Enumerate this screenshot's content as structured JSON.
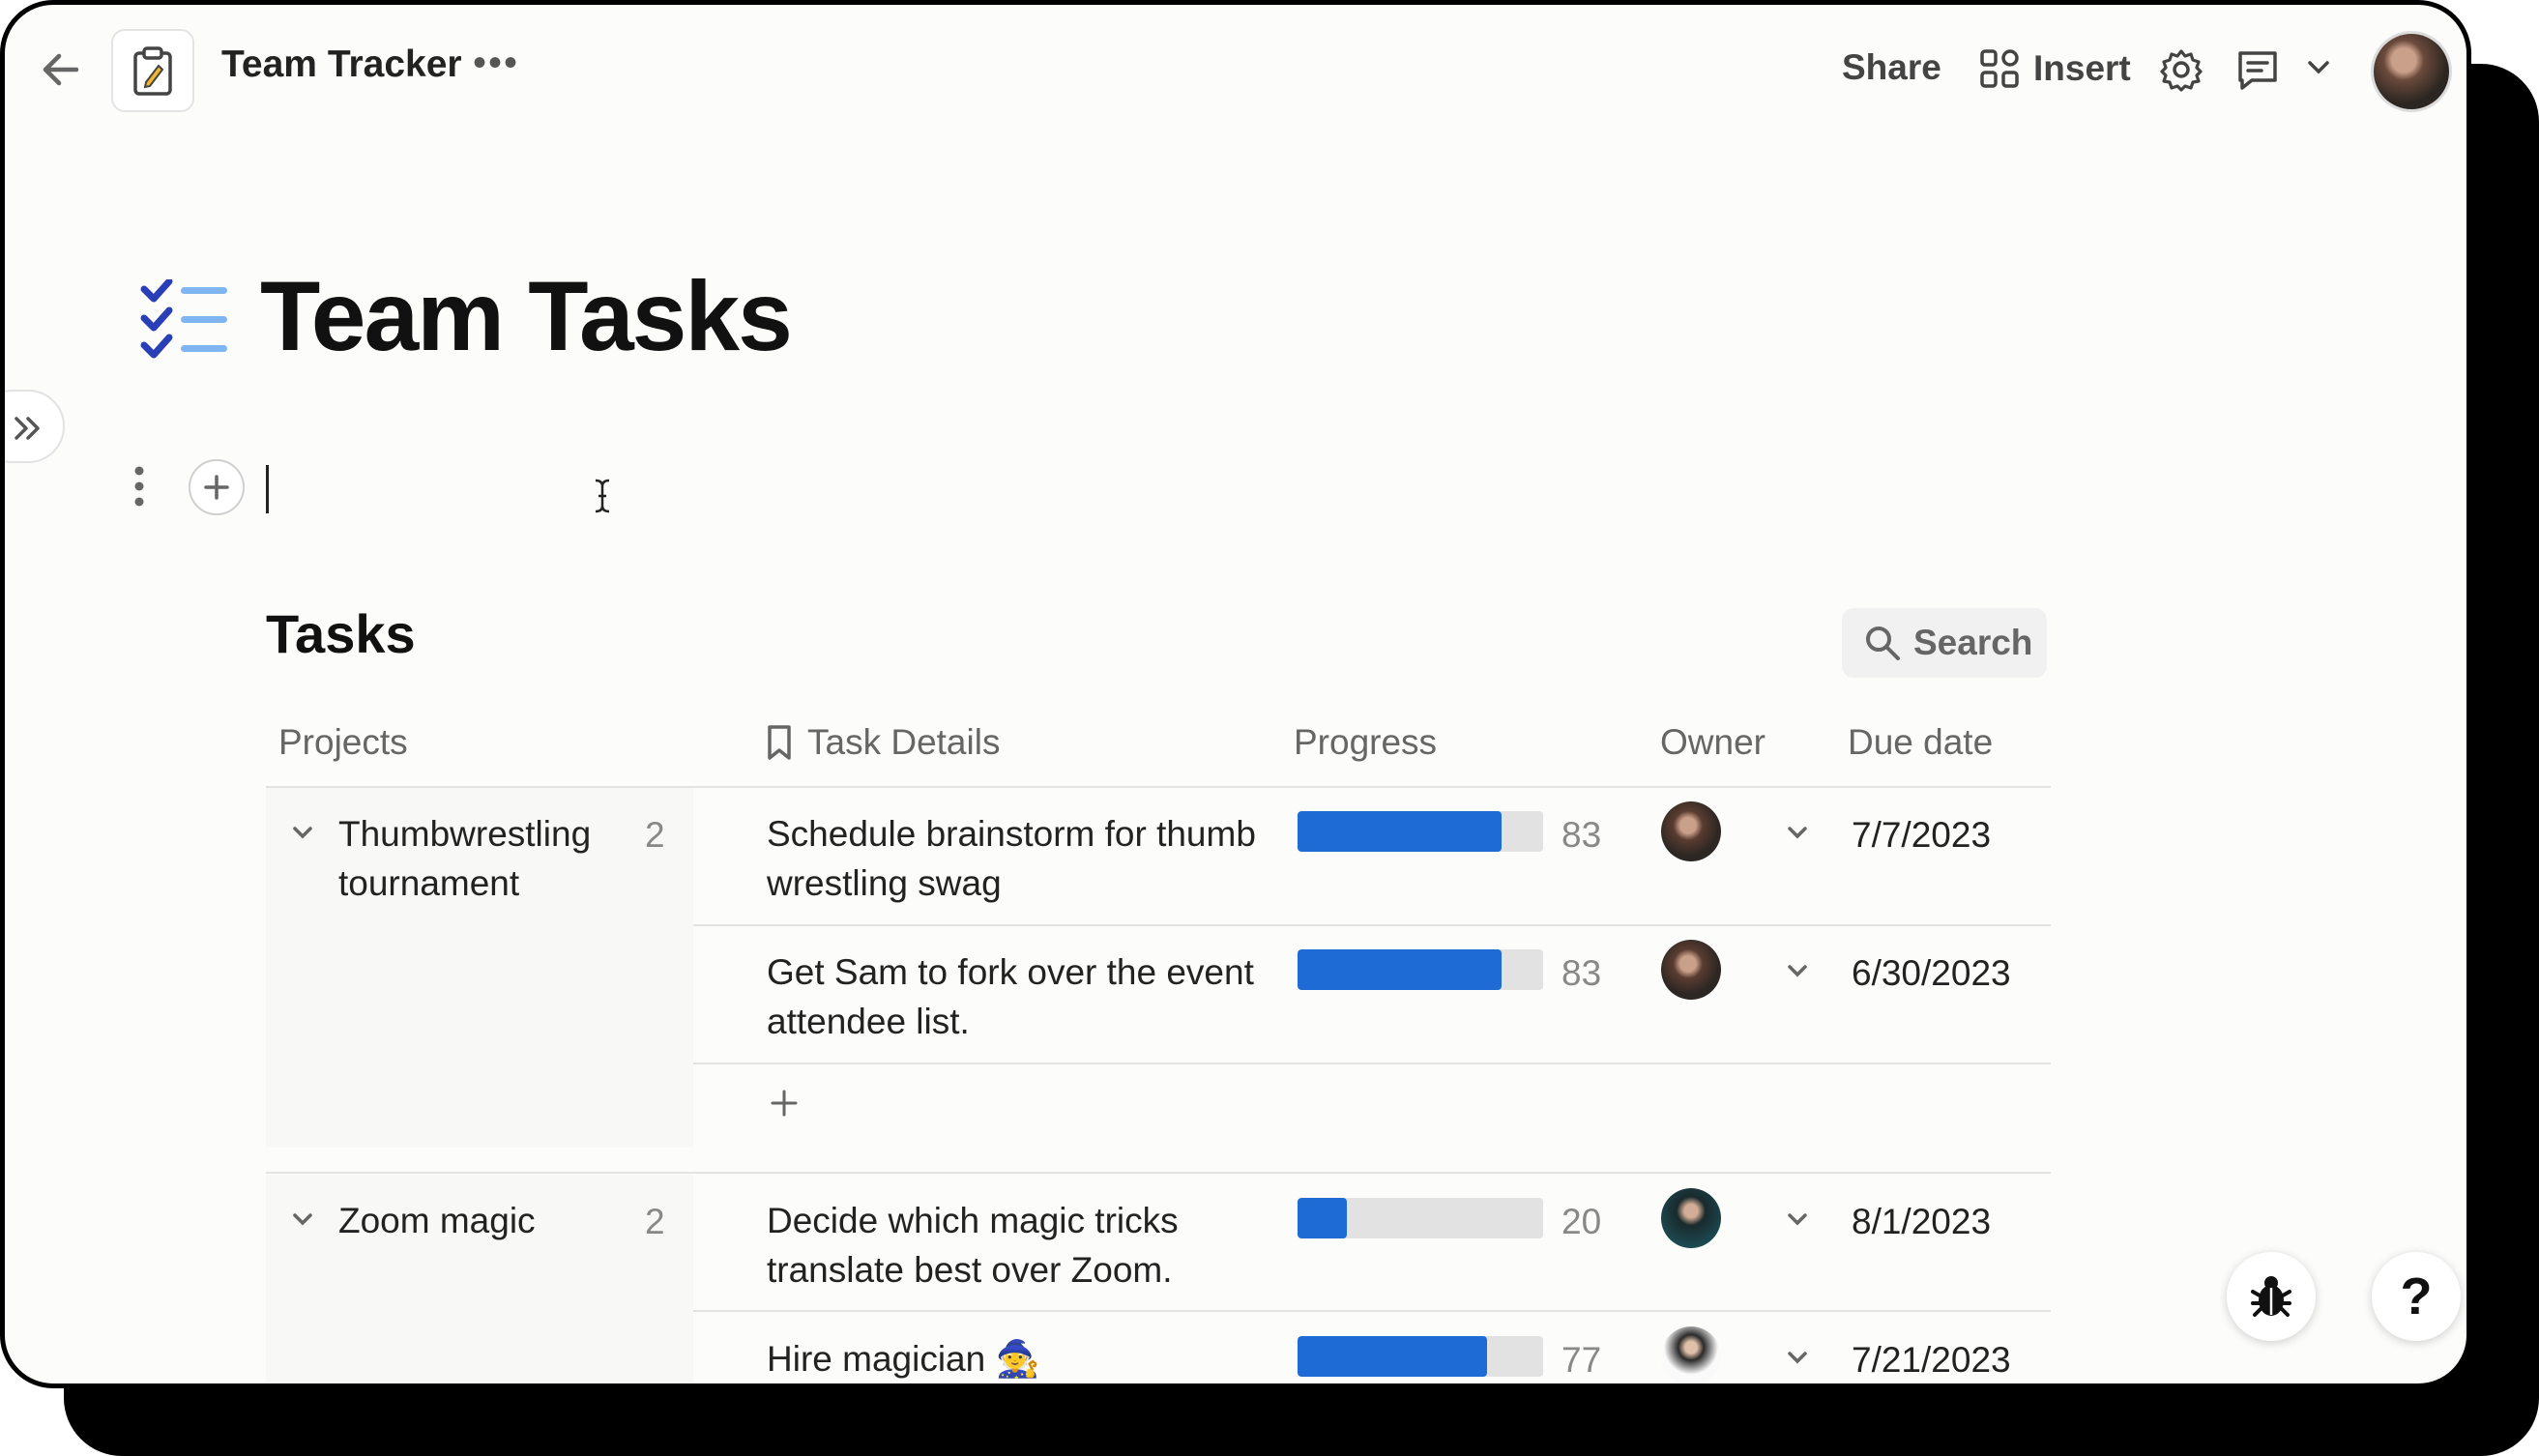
{
  "doc": {
    "title": "Team Tracker",
    "more": "•••"
  },
  "toolbar": {
    "share": "Share",
    "insert": "Insert"
  },
  "page": {
    "title": "Team Tasks"
  },
  "table": {
    "title": "Tasks",
    "search_label": "Search",
    "columns": [
      "Projects",
      "Task Details",
      "Progress",
      "Owner",
      "Due date"
    ],
    "groups": [
      {
        "name": "Thumbwrestling tournament",
        "count": "2",
        "rows": [
          {
            "task": "Schedule brainstorm for thumb wrestling swag",
            "progress": 83,
            "owner_avatar": "avatar-a",
            "due": "7/7/2023"
          },
          {
            "task": "Get Sam to fork over the event attendee list.",
            "progress": 83,
            "owner_avatar": "avatar-a",
            "due": "6/30/2023"
          }
        ]
      },
      {
        "name": "Zoom magic",
        "count": "2",
        "rows": [
          {
            "task": "Decide which magic tricks translate best over Zoom.",
            "progress": 20,
            "owner_avatar": "avatar-b",
            "due": "8/1/2023"
          },
          {
            "task": "Hire magician 🧙",
            "progress": 77,
            "owner_avatar": "avatar-c",
            "due": "7/21/2023"
          }
        ]
      }
    ]
  },
  "fabs": {
    "bug": "bug-icon",
    "help": "?"
  },
  "colors": {
    "accent": "#1f6bd6",
    "icon_blue_dark": "#2a3fb5",
    "icon_blue_light": "#7fb5f0"
  }
}
